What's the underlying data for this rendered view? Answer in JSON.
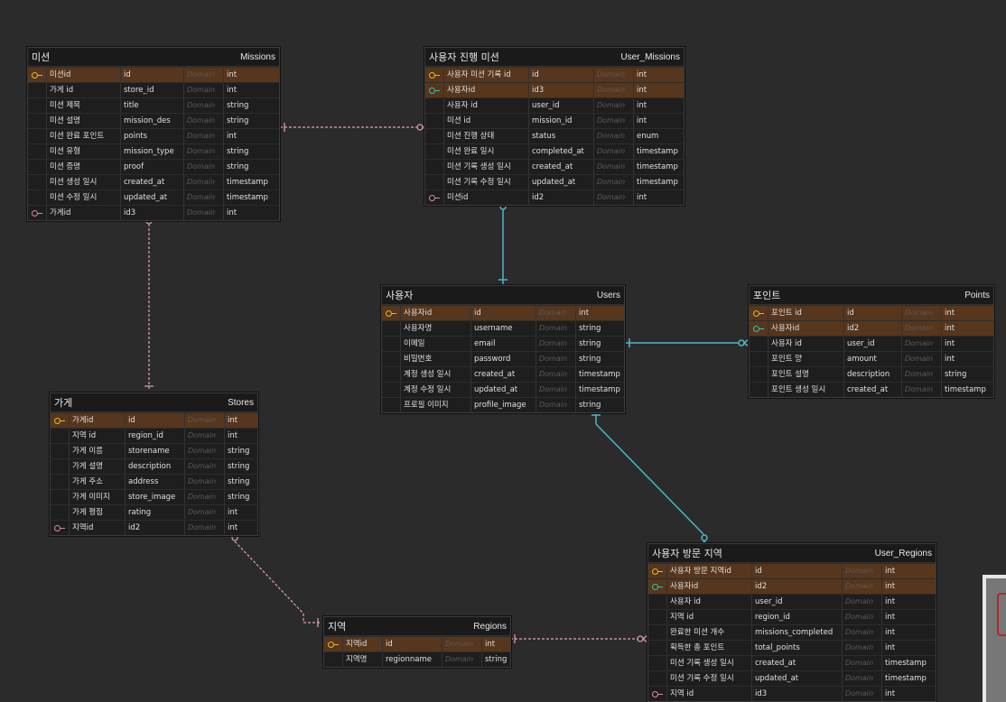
{
  "colors": {
    "fk_pink": "#e4a0b8",
    "fk_teal": "#4fb7c6",
    "pk_key": "#e8b62c"
  },
  "tables": [
    {
      "id": "missions",
      "logical": "미션",
      "physical": "Missions",
      "rows": [
        [
          "pk",
          "미션id",
          "id",
          "Domain",
          "int"
        ],
        [
          "",
          "가게 id",
          "store_id",
          "Domain",
          "int"
        ],
        [
          "",
          "미션 제목",
          "title",
          "Domain",
          "string"
        ],
        [
          "",
          "미션 설명",
          "mission_des",
          "Domain",
          "string"
        ],
        [
          "",
          "미션 완료 포인트",
          "points",
          "Domain",
          "int"
        ],
        [
          "",
          "미션 유형",
          "mission_type",
          "Domain",
          "string"
        ],
        [
          "",
          "미션 증명",
          "proof",
          "Domain",
          "string"
        ],
        [
          "",
          "미션 생성 일시",
          "created_at",
          "Domain",
          "timestamp"
        ],
        [
          "",
          "미션 수정 일시",
          "updated_at",
          "Domain",
          "timestamp"
        ],
        [
          "fk2",
          "가게id",
          "id3",
          "Domain",
          "int"
        ]
      ]
    },
    {
      "id": "user_missions",
      "logical": "사용자 진행 미션",
      "physical": "User_Missions",
      "rows": [
        [
          "pk",
          "사용자 미션 기록 id",
          "id",
          "Domain",
          "int"
        ],
        [
          "pkfk",
          "사용자id",
          "id3",
          "Domain",
          "int"
        ],
        [
          "",
          "사용자 id",
          "user_id",
          "Domain",
          "int"
        ],
        [
          "",
          "미션 id",
          "mission_id",
          "Domain",
          "int"
        ],
        [
          "",
          "미션 진행 상태",
          "status",
          "Domain",
          "enum"
        ],
        [
          "",
          "미션 완료 일시",
          "completed_at",
          "Domain",
          "timestamp"
        ],
        [
          "",
          "미션 기록 생성 일시",
          "created_at",
          "Domain",
          "timestamp"
        ],
        [
          "",
          "미션 기록 수정 일시",
          "updated_at",
          "Domain",
          "timestamp"
        ],
        [
          "fk2",
          "미션id",
          "id2",
          "Domain",
          "int"
        ]
      ]
    },
    {
      "id": "users",
      "logical": "사용자",
      "physical": "Users",
      "rows": [
        [
          "pk",
          "사용자id",
          "id",
          "Domain",
          "int"
        ],
        [
          "",
          "사용자명",
          "username",
          "Domain",
          "string"
        ],
        [
          "",
          "이메일",
          "email",
          "Domain",
          "string"
        ],
        [
          "",
          "비밀번호",
          "password",
          "Domain",
          "string"
        ],
        [
          "",
          "계정 생성 일시",
          "created_at",
          "Domain",
          "timestamp"
        ],
        [
          "",
          "계정 수정 일시",
          "updated_at",
          "Domain",
          "timestamp"
        ],
        [
          "",
          "프로필 이미지",
          "profile_image",
          "Domain",
          "string"
        ]
      ]
    },
    {
      "id": "points",
      "logical": "포인트",
      "physical": "Points",
      "rows": [
        [
          "pk",
          "포인트 id",
          "id",
          "Domain",
          "int"
        ],
        [
          "pkfk",
          "사용자id",
          "id2",
          "Domain",
          "int"
        ],
        [
          "",
          "사용자 id",
          "user_id",
          "Domain",
          "int"
        ],
        [
          "",
          "포인트 양",
          "amount",
          "Domain",
          "int"
        ],
        [
          "",
          "포인트 설명",
          "description",
          "Domain",
          "string"
        ],
        [
          "",
          "포인트 생성 일시",
          "created_at",
          "Domain",
          "timestamp"
        ]
      ]
    },
    {
      "id": "stores",
      "logical": "가게",
      "physical": "Stores",
      "rows": [
        [
          "pk",
          "가게id",
          "id",
          "Domain",
          "int"
        ],
        [
          "",
          "지역 id",
          "region_id",
          "Domain",
          "int"
        ],
        [
          "",
          "가게 이름",
          "storename",
          "Domain",
          "string"
        ],
        [
          "",
          "가게 설명",
          "description",
          "Domain",
          "string"
        ],
        [
          "",
          "가게 주소",
          "address",
          "Domain",
          "string"
        ],
        [
          "",
          "가게 이미지",
          "store_image",
          "Domain",
          "string"
        ],
        [
          "",
          "가게 평점",
          "rating",
          "Domain",
          "int"
        ],
        [
          "fk2",
          "지역id",
          "id2",
          "Domain",
          "int"
        ]
      ]
    },
    {
      "id": "regions",
      "logical": "지역",
      "physical": "Regions",
      "rows": [
        [
          "pk",
          "지역id",
          "id",
          "Domain",
          "int"
        ],
        [
          "",
          "지역명",
          "regionname",
          "Domain",
          "string"
        ]
      ]
    },
    {
      "id": "user_regions",
      "logical": "사용자 방문 지역",
      "physical": "User_Regions",
      "rows": [
        [
          "pk",
          "사용자 방문 지역id",
          "id",
          "Domain",
          "int"
        ],
        [
          "pkfk",
          "사용자id",
          "id2",
          "Domain",
          "int"
        ],
        [
          "",
          "사용자 id",
          "user_id",
          "Domain",
          "int"
        ],
        [
          "",
          "지역 id",
          "region_id",
          "Domain",
          "int"
        ],
        [
          "",
          "완료한 미션 개수",
          "missions_completed",
          "Domain",
          "int"
        ],
        [
          "",
          "획득한 총 포인트",
          "total_points",
          "Domain",
          "int"
        ],
        [
          "",
          "미션 기록 생성 일시",
          "created_at",
          "Domain",
          "timestamp"
        ],
        [
          "",
          "미션 기록 수정 일시",
          "updated_at",
          "Domain",
          "timestamp"
        ],
        [
          "fk2",
          "지역 id",
          "id3",
          "Domain",
          "int"
        ]
      ]
    }
  ]
}
